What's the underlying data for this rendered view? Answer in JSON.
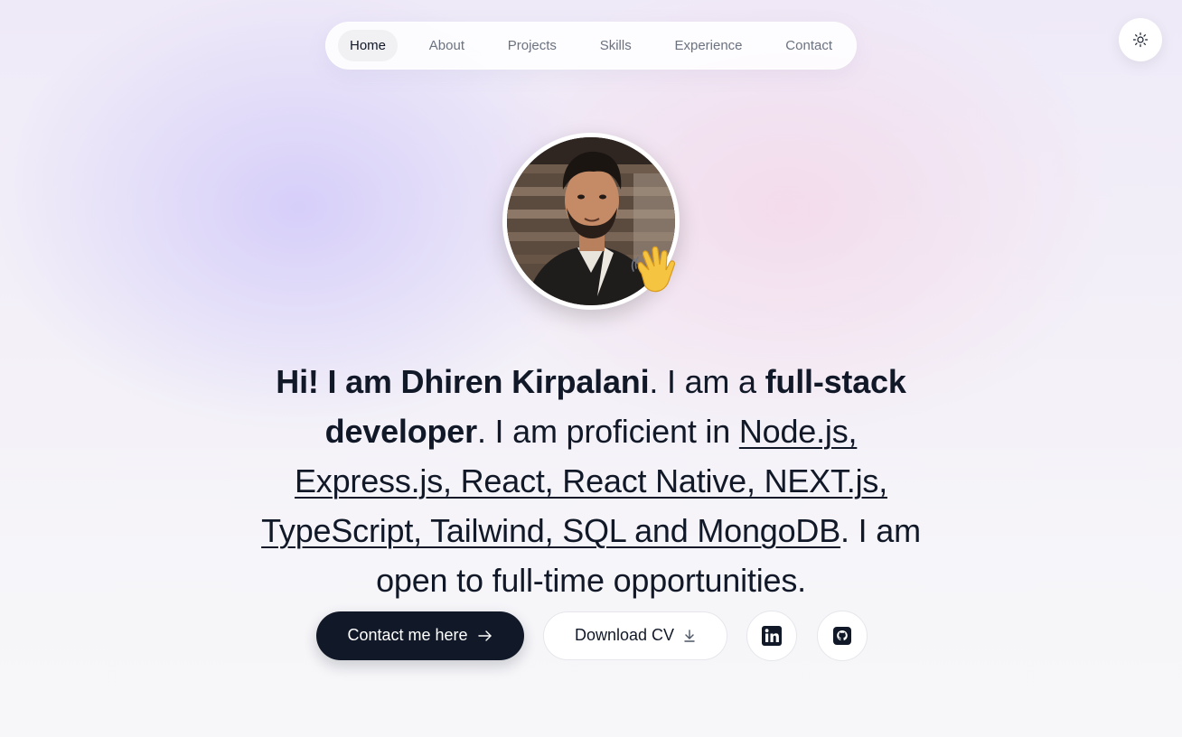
{
  "nav": {
    "items": [
      {
        "label": "Home",
        "active": true
      },
      {
        "label": "About",
        "active": false
      },
      {
        "label": "Projects",
        "active": false
      },
      {
        "label": "Skills",
        "active": false
      },
      {
        "label": "Experience",
        "active": false
      },
      {
        "label": "Contact",
        "active": false
      }
    ]
  },
  "theme_toggle": {
    "icon": "sun-icon"
  },
  "hero": {
    "avatar_icon": "profile-photo",
    "wave_icon": "waving-hand-icon",
    "intro": {
      "greeting": "Hi! I am Dhiren Kirpalani",
      "sep1": ". I am a ",
      "role": "full-stack developer",
      "sep2": ". I am proficient in ",
      "skills": "Node.js, Express.js, React, React Native, NEXT.js, TypeScript, Tailwind, SQL and MongoDB",
      "closing": ". I am open to full-time opportunities."
    },
    "buttons": {
      "contact_label": "Contact me here",
      "contact_icon": "arrow-right-icon",
      "cv_label": "Download CV",
      "cv_icon": "download-icon",
      "linkedin_icon": "linkedin-icon",
      "github_icon": "github-icon"
    }
  },
  "colors": {
    "primary_button": "#111827",
    "text": "#111827",
    "muted_text": "#6b7280"
  }
}
